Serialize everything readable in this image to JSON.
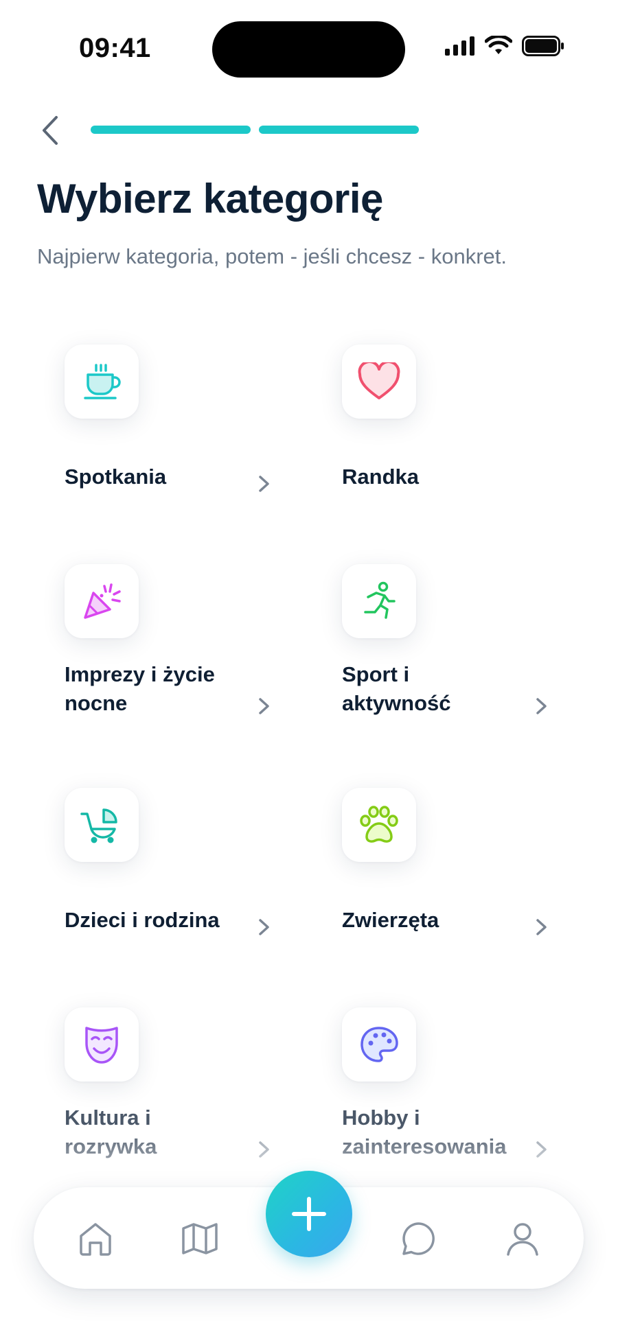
{
  "status_bar": {
    "time": "09:41"
  },
  "header": {
    "title": "Wybierz kategorię",
    "subtitle": "Najpierw kategoria, potem - jeśli chcesz - konkret.",
    "progress_steps_done": 2
  },
  "categories": [
    {
      "label": "Spotkania",
      "icon": "coffee-cup-icon",
      "color": "#1cc8c8"
    },
    {
      "label": "Randka",
      "icon": "heart-icon",
      "color": "#f0506e"
    },
    {
      "label": "Imprezy i życie nocne",
      "icon": "party-popper-icon",
      "color": "#d946ef"
    },
    {
      "label": "Sport i aktywność",
      "icon": "running-person-icon",
      "color": "#22c55e"
    },
    {
      "label": "Dzieci i rodzina",
      "icon": "baby-stroller-icon",
      "color": "#14b8a6"
    },
    {
      "label": "Zwierzęta",
      "icon": "paw-icon",
      "color": "#84cc16"
    },
    {
      "label": "Kultura i rozrywka",
      "icon": "theater-mask-icon",
      "color": "#a855f7"
    },
    {
      "label": "Hobby i zainteresowania",
      "icon": "palette-icon",
      "color": "#6366f1"
    }
  ],
  "tabbar": {
    "items": [
      "home-icon",
      "map-icon",
      "add-icon",
      "chat-icon",
      "profile-icon"
    ]
  },
  "colors": {
    "accent": "#1cc8c8",
    "title": "#0e2035",
    "subtitle": "#6a7787"
  }
}
